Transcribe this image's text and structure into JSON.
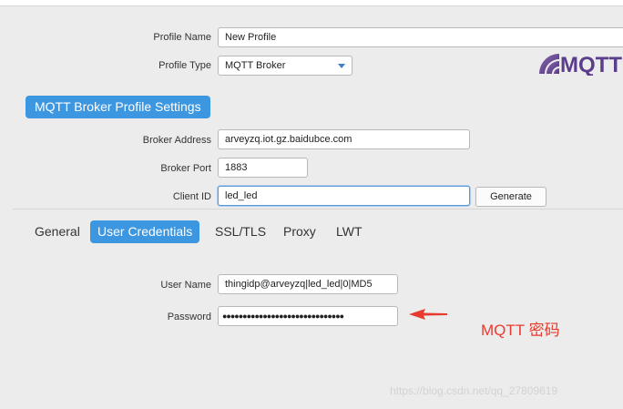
{
  "profile": {
    "name_label": "Profile Name",
    "name_value": "New Profile",
    "type_label": "Profile Type",
    "type_value": "MQTT Broker"
  },
  "logo_text": "MQTT",
  "section_title": "MQTT Broker Profile Settings",
  "broker": {
    "address_label": "Broker Address",
    "address_value": "arveyzq.iot.gz.baidubce.com",
    "port_label": "Broker Port",
    "port_value": "1883",
    "client_id_label": "Client ID",
    "client_id_value": "led_led",
    "generate_label": "Generate"
  },
  "tabs": [
    {
      "label": "General"
    },
    {
      "label": "User Credentials"
    },
    {
      "label": "SSL/TLS"
    },
    {
      "label": "Proxy"
    },
    {
      "label": "LWT"
    }
  ],
  "credentials": {
    "user_label": "User Name",
    "user_value": "thingidp@arveyzq|led_led|0|MD5",
    "password_label": "Password",
    "password_value": "●●●●●●●●●●●●●●●●●●●●●●●●●●●●●●"
  },
  "annotation": "MQTT 密码",
  "watermark": "https://blog.csdn.net/qq_27809619",
  "colors": {
    "accent": "#3d96e0",
    "annotation": "#e83a2e",
    "panel": "#ececec"
  }
}
